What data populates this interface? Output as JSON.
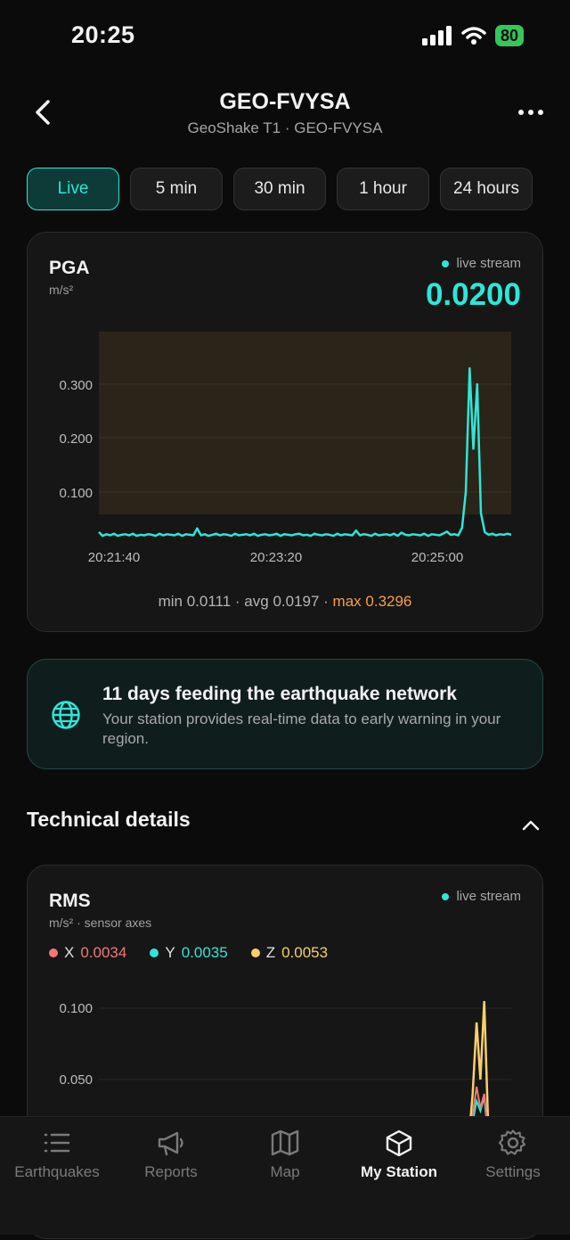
{
  "status": {
    "time": "20:25",
    "battery": "80"
  },
  "header": {
    "title": "GEO-FVYSA",
    "subtitle": "GeoShake T1 · GEO-FVYSA"
  },
  "tabs": [
    {
      "label": "Live",
      "active": true
    },
    {
      "label": "5 min"
    },
    {
      "label": "30 min"
    },
    {
      "label": "1 hour"
    },
    {
      "label": "24 hours"
    }
  ],
  "pga": {
    "title": "PGA",
    "unit": "m/s²",
    "live_label": "live stream",
    "current": "0.0200",
    "stats_prefix": "min 0.0111 · avg 0.0197 · ",
    "stats_max": "max 0.3296",
    "y_ticks": [
      "0.300",
      "0.200",
      "0.100"
    ],
    "x_ticks": [
      "20:21:40",
      "20:23:20",
      "20:25:00"
    ]
  },
  "chart_data": [
    {
      "type": "line",
      "title": "PGA",
      "ylabel": "m/s²",
      "ylim": [
        0,
        0.38
      ],
      "x_ticks": [
        "20:21:40",
        "20:23:20",
        "20:25:00"
      ],
      "series": [
        {
          "values": [
            0.025,
            0.018,
            0.021,
            0.019,
            0.022,
            0.018,
            0.02,
            0.021,
            0.019,
            0.022,
            0.018,
            0.02,
            0.019,
            0.021,
            0.02,
            0.018,
            0.022,
            0.019,
            0.021,
            0.02,
            0.019,
            0.022,
            0.018,
            0.021,
            0.02,
            0.019,
            0.032,
            0.019,
            0.021,
            0.018,
            0.02,
            0.022,
            0.019,
            0.021,
            0.02,
            0.018,
            0.022,
            0.019,
            0.02,
            0.021,
            0.019,
            0.022,
            0.018,
            0.02,
            0.021,
            0.019,
            0.02,
            0.022,
            0.018,
            0.021,
            0.02,
            0.019,
            0.021,
            0.022,
            0.019,
            0.02,
            0.018,
            0.022,
            0.02,
            0.019,
            0.021,
            0.02,
            0.018,
            0.022,
            0.019,
            0.021,
            0.02,
            0.019,
            0.028,
            0.019,
            0.021,
            0.02,
            0.018,
            0.022,
            0.019,
            0.02,
            0.021,
            0.019,
            0.022,
            0.018,
            0.024,
            0.02,
            0.019,
            0.021,
            0.02,
            0.019,
            0.022,
            0.018,
            0.021,
            0.02,
            0.019,
            0.022,
            0.026,
            0.02,
            0.021,
            0.019,
            0.033,
            0.1,
            0.3296,
            0.18,
            0.3,
            0.06,
            0.025,
            0.02,
            0.022,
            0.019,
            0.021,
            0.02,
            0.022,
            0.02
          ]
        }
      ]
    },
    {
      "type": "line",
      "title": "RMS",
      "ylabel": "m/s²",
      "ylim": [
        0,
        0.13
      ],
      "series": [
        {
          "name": "X",
          "values": [
            0.004,
            0.004,
            0.004,
            0.004,
            0.004,
            0.004,
            0.004,
            0.004,
            0.004,
            0.004,
            0.004,
            0.004,
            0.004,
            0.004,
            0.004,
            0.004,
            0.004,
            0.004,
            0.004,
            0.004,
            0.004,
            0.004,
            0.004,
            0.004,
            0.004,
            0.004,
            0.004,
            0.004,
            0.004,
            0.004,
            0.004,
            0.004,
            0.004,
            0.004,
            0.004,
            0.004,
            0.004,
            0.004,
            0.004,
            0.004,
            0.004,
            0.004,
            0.004,
            0.004,
            0.004,
            0.004,
            0.004,
            0.004,
            0.004,
            0.004,
            0.004,
            0.004,
            0.004,
            0.004,
            0.004,
            0.004,
            0.004,
            0.004,
            0.004,
            0.004,
            0.004,
            0.004,
            0.004,
            0.004,
            0.004,
            0.004,
            0.004,
            0.004,
            0.004,
            0.004,
            0.004,
            0.004,
            0.004,
            0.004,
            0.004,
            0.004,
            0.004,
            0.004,
            0.004,
            0.004,
            0.004,
            0.004,
            0.004,
            0.004,
            0.004,
            0.004,
            0.004,
            0.004,
            0.004,
            0.004,
            0.004,
            0.004,
            0.004,
            0.004,
            0.004,
            0.004,
            0.006,
            0.025,
            0.045,
            0.03,
            0.04,
            0.012,
            0.005,
            0.004,
            0.004,
            0.004,
            0.004,
            0.004
          ]
        },
        {
          "name": "Y",
          "values": [
            0.004,
            0.004,
            0.004,
            0.004,
            0.004,
            0.004,
            0.004,
            0.004,
            0.004,
            0.004,
            0.004,
            0.004,
            0.004,
            0.004,
            0.004,
            0.004,
            0.004,
            0.004,
            0.004,
            0.004,
            0.004,
            0.004,
            0.004,
            0.004,
            0.004,
            0.004,
            0.004,
            0.004,
            0.004,
            0.004,
            0.004,
            0.004,
            0.004,
            0.004,
            0.004,
            0.004,
            0.004,
            0.004,
            0.004,
            0.004,
            0.004,
            0.004,
            0.004,
            0.004,
            0.004,
            0.004,
            0.004,
            0.004,
            0.004,
            0.004,
            0.004,
            0.004,
            0.004,
            0.004,
            0.004,
            0.004,
            0.004,
            0.004,
            0.004,
            0.004,
            0.004,
            0.004,
            0.004,
            0.004,
            0.004,
            0.004,
            0.004,
            0.004,
            0.004,
            0.004,
            0.004,
            0.004,
            0.004,
            0.004,
            0.004,
            0.004,
            0.004,
            0.004,
            0.004,
            0.004,
            0.004,
            0.004,
            0.004,
            0.004,
            0.004,
            0.004,
            0.004,
            0.004,
            0.004,
            0.004,
            0.004,
            0.004,
            0.004,
            0.004,
            0.004,
            0.004,
            0.006,
            0.02,
            0.035,
            0.028,
            0.038,
            0.01,
            0.005,
            0.004,
            0.004,
            0.004,
            0.004,
            0.004
          ]
        },
        {
          "name": "Z",
          "values": [
            0.005,
            0.005,
            0.005,
            0.005,
            0.005,
            0.005,
            0.005,
            0.005,
            0.005,
            0.005,
            0.005,
            0.005,
            0.005,
            0.005,
            0.005,
            0.005,
            0.005,
            0.005,
            0.005,
            0.005,
            0.005,
            0.005,
            0.005,
            0.005,
            0.005,
            0.005,
            0.005,
            0.005,
            0.005,
            0.005,
            0.005,
            0.005,
            0.005,
            0.005,
            0.005,
            0.005,
            0.005,
            0.005,
            0.005,
            0.005,
            0.005,
            0.005,
            0.005,
            0.005,
            0.005,
            0.005,
            0.005,
            0.005,
            0.005,
            0.005,
            0.005,
            0.005,
            0.005,
            0.005,
            0.005,
            0.005,
            0.005,
            0.005,
            0.005,
            0.005,
            0.005,
            0.005,
            0.005,
            0.005,
            0.005,
            0.005,
            0.005,
            0.005,
            0.005,
            0.005,
            0.005,
            0.005,
            0.005,
            0.005,
            0.005,
            0.005,
            0.005,
            0.005,
            0.005,
            0.005,
            0.005,
            0.005,
            0.005,
            0.005,
            0.005,
            0.005,
            0.005,
            0.005,
            0.005,
            0.005,
            0.005,
            0.005,
            0.005,
            0.005,
            0.005,
            0.005,
            0.008,
            0.04,
            0.09,
            0.05,
            0.105,
            0.02,
            0.006,
            0.005,
            0.005,
            0.005,
            0.005,
            0.005
          ]
        }
      ]
    }
  ],
  "banner": {
    "title": "11 days feeding the earthquake network",
    "text": "Your station provides real-time data to early warning in your region."
  },
  "technical": {
    "title": "Technical details"
  },
  "rms": {
    "title": "RMS",
    "unit": "m/s² · sensor axes",
    "live_label": "live stream",
    "x_label": "X",
    "x_value": "0.0034",
    "y_label": "Y",
    "y_value": "0.0035",
    "z_label": "Z",
    "z_value": "0.0053",
    "y_ticks": [
      "0.100",
      "0.050"
    ]
  },
  "colors": {
    "accent": "#2ee6d6",
    "x": "#f07a72",
    "y": "#2ee6d6",
    "z": "#f5d06a",
    "max": "#f5a04a"
  },
  "nav": [
    {
      "label": "Earthquakes",
      "icon": "list-icon"
    },
    {
      "label": "Reports",
      "icon": "megaphone-icon"
    },
    {
      "label": "Map",
      "icon": "map-icon"
    },
    {
      "label": "My Station",
      "icon": "cube-icon",
      "active": true
    },
    {
      "label": "Settings",
      "icon": "gear-icon"
    }
  ]
}
